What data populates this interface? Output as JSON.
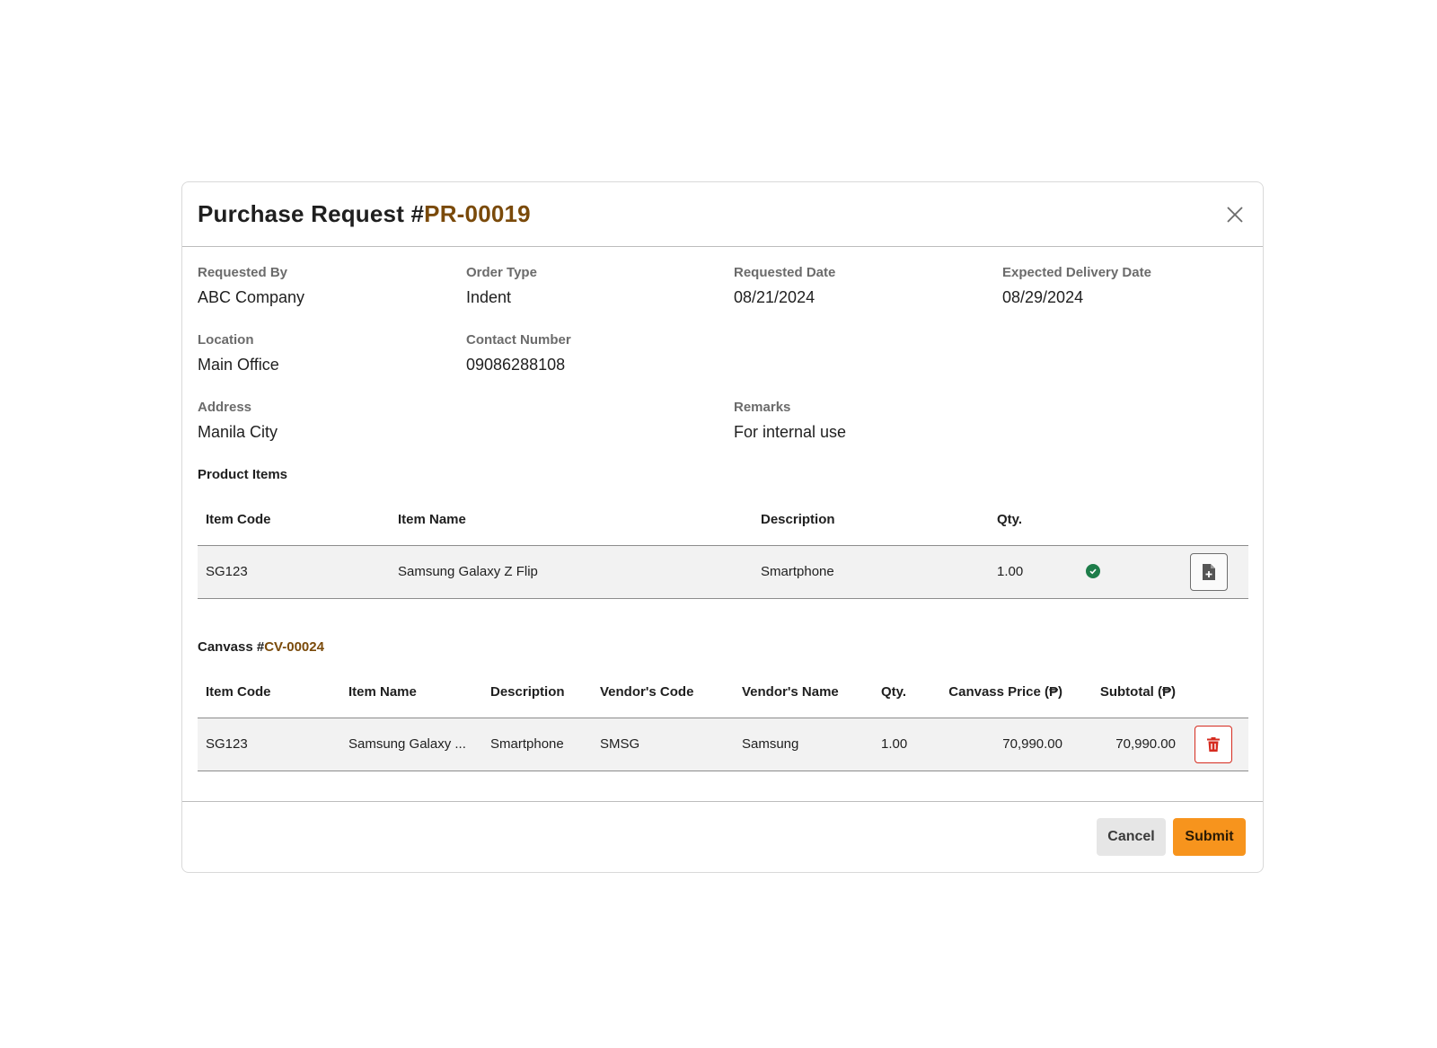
{
  "modal": {
    "title_prefix": "Purchase Request #",
    "pr_number": "PR-00019"
  },
  "fields": {
    "requested_by": {
      "label": "Requested By",
      "value": "ABC Company"
    },
    "order_type": {
      "label": "Order Type",
      "value": "Indent"
    },
    "requested_date": {
      "label": "Requested Date",
      "value": "08/21/2024"
    },
    "expected_delivery_date": {
      "label": "Expected Delivery Date",
      "value": "08/29/2024"
    },
    "location": {
      "label": "Location",
      "value": "Main Office"
    },
    "contact_number": {
      "label": "Contact Number",
      "value": "09086288108"
    },
    "address": {
      "label": "Address",
      "value": "Manila City"
    },
    "remarks": {
      "label": "Remarks",
      "value": "For internal use"
    }
  },
  "product_items": {
    "title": "Product Items",
    "headers": [
      "Item Code",
      "Item Name",
      "Description",
      "Qty."
    ],
    "rows": [
      {
        "item_code": "SG123",
        "item_name": "Samsung Galaxy Z Flip",
        "description": "Smartphone",
        "qty": "1.00",
        "status_icon": "check-circle-icon",
        "action_icon": "file-add-icon"
      }
    ]
  },
  "canvass": {
    "title_prefix": "Canvass #",
    "cv_number": "CV-00024",
    "headers": [
      "Item Code",
      "Item Name",
      "Description",
      "Vendor's Code",
      "Vendor's Name",
      "Qty.",
      "Canvass Price (₱)",
      "Subtotal (₱)"
    ],
    "rows": [
      {
        "item_code": "SG123",
        "item_name": "Samsung Galaxy ...",
        "description": "Smartphone",
        "vendor_code": "SMSG",
        "vendor_name": "Samsung",
        "qty": "1.00",
        "canvass_price": "70,990.00",
        "subtotal": "70,990.00",
        "action_icon": "trash-icon"
      }
    ]
  },
  "footer": {
    "cancel_label": "Cancel",
    "submit_label": "Submit"
  },
  "colors": {
    "accent_brown": "#7a4a0a",
    "submit_orange": "#f7941d",
    "delete_red": "#d62b1f",
    "success_green": "#1e7d4a"
  }
}
